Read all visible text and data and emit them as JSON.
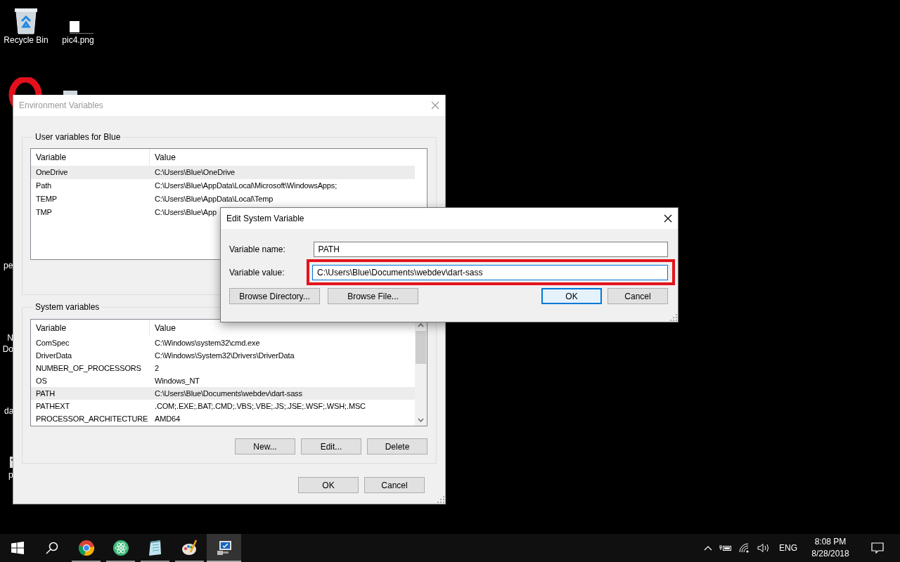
{
  "desktop_icons": [
    {
      "kind": "recycle",
      "label": "Recycle Bin"
    },
    {
      "kind": "image-file",
      "label": "pic4.png"
    },
    {
      "kind": "opera"
    },
    {
      "kind": "file"
    },
    {
      "kind": "hidden",
      "label_lines": [
        "pe"
      ]
    },
    {
      "kind": "hidden",
      "label_lines": [
        "N",
        "Do"
      ]
    },
    {
      "kind": "hidden",
      "label_lines": [
        "da"
      ]
    },
    {
      "kind": "small-app",
      "label_lines": [
        "p"
      ]
    }
  ],
  "env_dialog": {
    "title": "Environment Variables",
    "user_group": {
      "title": "User variables for Blue",
      "columns": [
        "Variable",
        "Value"
      ],
      "rows": [
        {
          "variable": "OneDrive",
          "value": "C:\\Users\\Blue\\OneDrive",
          "selected": true
        },
        {
          "variable": "Path",
          "value": "C:\\Users\\Blue\\AppData\\Local\\Microsoft\\WindowsApps;",
          "selected": false
        },
        {
          "variable": "TEMP",
          "value": "C:\\Users\\Blue\\AppData\\Local\\Temp",
          "selected": false
        },
        {
          "variable": "TMP",
          "value": "C:\\Users\\Blue\\App",
          "selected": false
        }
      ]
    },
    "system_group": {
      "title": "System variables",
      "columns": [
        "Variable",
        "Value"
      ],
      "rows": [
        {
          "variable": "ComSpec",
          "value": "C:\\Windows\\system32\\cmd.exe",
          "selected": false
        },
        {
          "variable": "DriverData",
          "value": "C:\\Windows\\System32\\Drivers\\DriverData",
          "selected": false
        },
        {
          "variable": "NUMBER_OF_PROCESSORS",
          "value": "2",
          "selected": false
        },
        {
          "variable": "OS",
          "value": "Windows_NT",
          "selected": false
        },
        {
          "variable": "PATH",
          "value": "C:\\Users\\Blue\\Documents\\webdev\\dart-sass",
          "selected": true
        },
        {
          "variable": "PATHEXT",
          "value": ".COM;.EXE;.BAT;.CMD;.VBS;.VBE;.JS;.JSE;.WSF;.WSH;.MSC",
          "selected": false
        },
        {
          "variable": "PROCESSOR_ARCHITECTURE",
          "value": "AMD64",
          "selected": false
        }
      ],
      "buttons": [
        "New...",
        "Edit...",
        "Delete"
      ]
    },
    "buttons": [
      "OK",
      "Cancel"
    ]
  },
  "edit_dialog": {
    "title": "Edit System Variable",
    "name_label": "Variable name:",
    "name_value": "PATH",
    "value_label": "Variable value:",
    "value_value": "C:\\Users\\Blue\\Documents\\webdev\\dart-sass",
    "value_highlighted": true,
    "left_buttons": [
      "Browse Directory...",
      "Browse File..."
    ],
    "right_buttons": [
      {
        "label": "OK",
        "focused": true
      },
      {
        "label": "Cancel",
        "focused": false
      }
    ]
  },
  "taskbar": {
    "apps": [
      {
        "kind": "chrome",
        "active": false
      },
      {
        "kind": "atom",
        "active": false
      },
      {
        "kind": "notepad",
        "active": false
      },
      {
        "kind": "paint",
        "active": false
      },
      {
        "kind": "system",
        "active": true
      }
    ],
    "language": "ENG",
    "time": "8:08 PM",
    "date": "8/28/2018"
  }
}
